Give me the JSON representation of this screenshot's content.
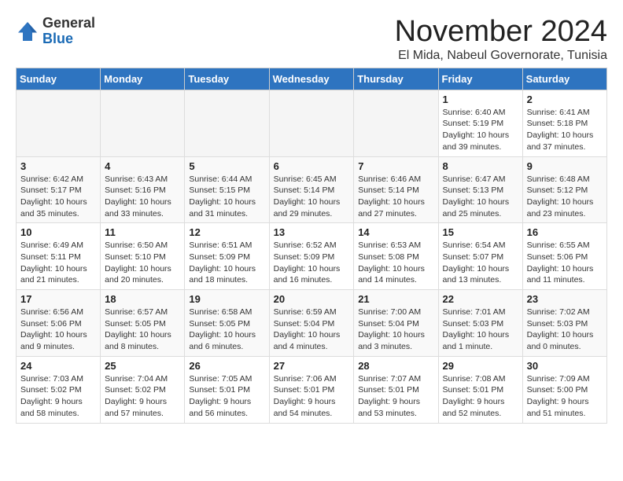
{
  "logo": {
    "general": "General",
    "blue": "Blue"
  },
  "title": "November 2024",
  "location": "El Mida, Nabeul Governorate, Tunisia",
  "headers": [
    "Sunday",
    "Monday",
    "Tuesday",
    "Wednesday",
    "Thursday",
    "Friday",
    "Saturday"
  ],
  "weeks": [
    [
      {
        "day": "",
        "info": ""
      },
      {
        "day": "",
        "info": ""
      },
      {
        "day": "",
        "info": ""
      },
      {
        "day": "",
        "info": ""
      },
      {
        "day": "",
        "info": ""
      },
      {
        "day": "1",
        "info": "Sunrise: 6:40 AM\nSunset: 5:19 PM\nDaylight: 10 hours and 39 minutes."
      },
      {
        "day": "2",
        "info": "Sunrise: 6:41 AM\nSunset: 5:18 PM\nDaylight: 10 hours and 37 minutes."
      }
    ],
    [
      {
        "day": "3",
        "info": "Sunrise: 6:42 AM\nSunset: 5:17 PM\nDaylight: 10 hours and 35 minutes."
      },
      {
        "day": "4",
        "info": "Sunrise: 6:43 AM\nSunset: 5:16 PM\nDaylight: 10 hours and 33 minutes."
      },
      {
        "day": "5",
        "info": "Sunrise: 6:44 AM\nSunset: 5:15 PM\nDaylight: 10 hours and 31 minutes."
      },
      {
        "day": "6",
        "info": "Sunrise: 6:45 AM\nSunset: 5:14 PM\nDaylight: 10 hours and 29 minutes."
      },
      {
        "day": "7",
        "info": "Sunrise: 6:46 AM\nSunset: 5:14 PM\nDaylight: 10 hours and 27 minutes."
      },
      {
        "day": "8",
        "info": "Sunrise: 6:47 AM\nSunset: 5:13 PM\nDaylight: 10 hours and 25 minutes."
      },
      {
        "day": "9",
        "info": "Sunrise: 6:48 AM\nSunset: 5:12 PM\nDaylight: 10 hours and 23 minutes."
      }
    ],
    [
      {
        "day": "10",
        "info": "Sunrise: 6:49 AM\nSunset: 5:11 PM\nDaylight: 10 hours and 21 minutes."
      },
      {
        "day": "11",
        "info": "Sunrise: 6:50 AM\nSunset: 5:10 PM\nDaylight: 10 hours and 20 minutes."
      },
      {
        "day": "12",
        "info": "Sunrise: 6:51 AM\nSunset: 5:09 PM\nDaylight: 10 hours and 18 minutes."
      },
      {
        "day": "13",
        "info": "Sunrise: 6:52 AM\nSunset: 5:09 PM\nDaylight: 10 hours and 16 minutes."
      },
      {
        "day": "14",
        "info": "Sunrise: 6:53 AM\nSunset: 5:08 PM\nDaylight: 10 hours and 14 minutes."
      },
      {
        "day": "15",
        "info": "Sunrise: 6:54 AM\nSunset: 5:07 PM\nDaylight: 10 hours and 13 minutes."
      },
      {
        "day": "16",
        "info": "Sunrise: 6:55 AM\nSunset: 5:06 PM\nDaylight: 10 hours and 11 minutes."
      }
    ],
    [
      {
        "day": "17",
        "info": "Sunrise: 6:56 AM\nSunset: 5:06 PM\nDaylight: 10 hours and 9 minutes."
      },
      {
        "day": "18",
        "info": "Sunrise: 6:57 AM\nSunset: 5:05 PM\nDaylight: 10 hours and 8 minutes."
      },
      {
        "day": "19",
        "info": "Sunrise: 6:58 AM\nSunset: 5:05 PM\nDaylight: 10 hours and 6 minutes."
      },
      {
        "day": "20",
        "info": "Sunrise: 6:59 AM\nSunset: 5:04 PM\nDaylight: 10 hours and 4 minutes."
      },
      {
        "day": "21",
        "info": "Sunrise: 7:00 AM\nSunset: 5:04 PM\nDaylight: 10 hours and 3 minutes."
      },
      {
        "day": "22",
        "info": "Sunrise: 7:01 AM\nSunset: 5:03 PM\nDaylight: 10 hours and 1 minute."
      },
      {
        "day": "23",
        "info": "Sunrise: 7:02 AM\nSunset: 5:03 PM\nDaylight: 10 hours and 0 minutes."
      }
    ],
    [
      {
        "day": "24",
        "info": "Sunrise: 7:03 AM\nSunset: 5:02 PM\nDaylight: 9 hours and 58 minutes."
      },
      {
        "day": "25",
        "info": "Sunrise: 7:04 AM\nSunset: 5:02 PM\nDaylight: 9 hours and 57 minutes."
      },
      {
        "day": "26",
        "info": "Sunrise: 7:05 AM\nSunset: 5:01 PM\nDaylight: 9 hours and 56 minutes."
      },
      {
        "day": "27",
        "info": "Sunrise: 7:06 AM\nSunset: 5:01 PM\nDaylight: 9 hours and 54 minutes."
      },
      {
        "day": "28",
        "info": "Sunrise: 7:07 AM\nSunset: 5:01 PM\nDaylight: 9 hours and 53 minutes."
      },
      {
        "day": "29",
        "info": "Sunrise: 7:08 AM\nSunset: 5:01 PM\nDaylight: 9 hours and 52 minutes."
      },
      {
        "day": "30",
        "info": "Sunrise: 7:09 AM\nSunset: 5:00 PM\nDaylight: 9 hours and 51 minutes."
      }
    ]
  ]
}
